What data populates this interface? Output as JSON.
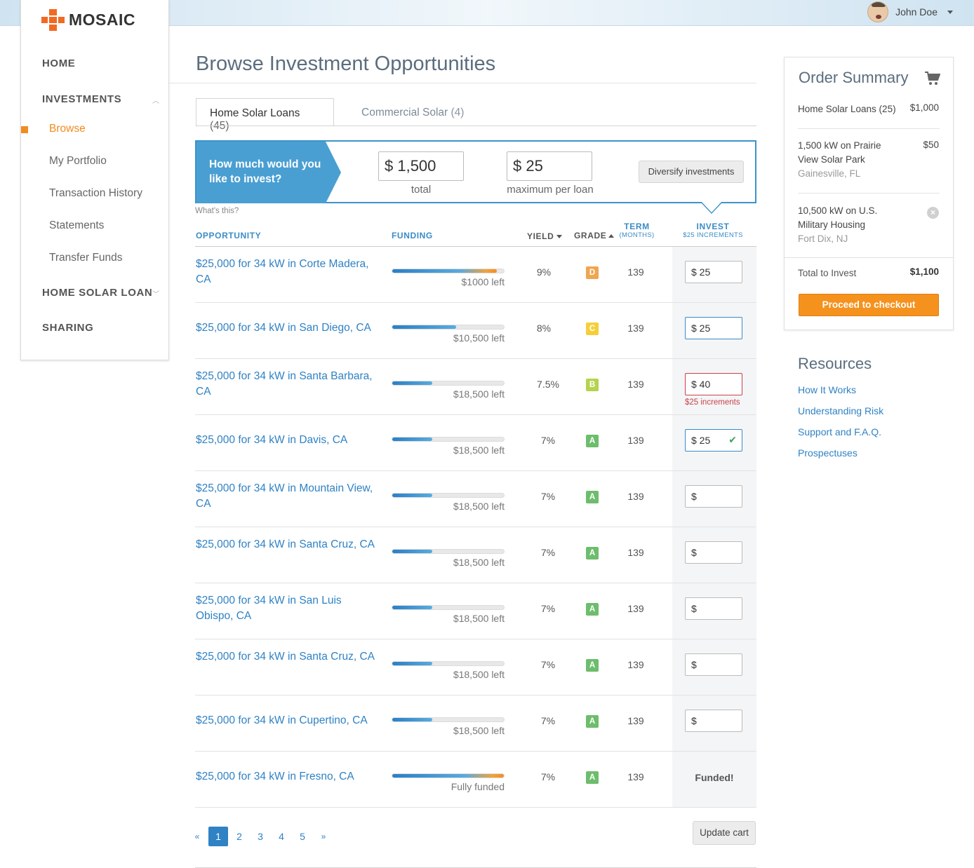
{
  "brand": {
    "name": "MOSAIC",
    "accent": "#f26a21"
  },
  "user": {
    "name": "John Doe"
  },
  "nav": {
    "home": "HOME",
    "investments": "INVESTMENTS",
    "sub": [
      {
        "label": "Browse",
        "active": true
      },
      {
        "label": "My Portfolio"
      },
      {
        "label": "Transaction History"
      },
      {
        "label": "Statements"
      },
      {
        "label": "Transfer Funds"
      }
    ],
    "home_solar_loan": "HOME SOLAR LOAN",
    "sharing": "SHARING"
  },
  "page": {
    "title": "Browse Investment Opportunities"
  },
  "tabs": [
    {
      "label": "Home Solar Loans",
      "count": "(45)",
      "active": true
    },
    {
      "label": "Commercial Solar",
      "count": "(4)",
      "active": false
    }
  ],
  "invest_box": {
    "prompt": "How much would you like to invest?",
    "total_value": "$ 1,500",
    "total_caption": "total",
    "max_value": "$ 25",
    "max_caption": "maximum per loan",
    "diversify_label": "Diversify investments",
    "whats_this": "What's this?"
  },
  "table": {
    "headers": {
      "opportunity": "OPPORTUNITY",
      "funding": "FUNDING",
      "yield": "YIELD",
      "grade": "GRADE",
      "term": "TERM",
      "term_sub": "(MONTHS)",
      "invest": "INVEST",
      "invest_sub": "$25 INCREMENTS"
    },
    "rows": [
      {
        "title": "$25,000 for 34 kW in Corte Madera, CA",
        "funded_fraction": 0.94,
        "left": "$1000 left",
        "yield": "9%",
        "grade": "D",
        "grade_color": "#f0a551",
        "term": "139",
        "invest": "$ 25",
        "state": "normal"
      },
      {
        "title": "$25,000 for 34 kW in San Diego, CA",
        "funded_fraction": 0.57,
        "left": "$10,500 left",
        "yield": "8%",
        "grade": "C",
        "grade_color": "#f5cf3a",
        "term": "139",
        "invest": "$ 25",
        "state": "focus"
      },
      {
        "title": "$25,000 for 34 kW in Santa Barbara, CA",
        "funded_fraction": 0.36,
        "left": "$18,500 left",
        "yield": "7.5%",
        "grade": "B",
        "grade_color": "#b5d34e",
        "term": "139",
        "invest": "$ 40",
        "state": "error",
        "error": "$25 increments"
      },
      {
        "title": "$25,000 for 34 kW in Davis, CA",
        "funded_fraction": 0.36,
        "left": "$18,500 left",
        "yield": "7%",
        "grade": "A",
        "grade_color": "#6dbd6d",
        "term": "139",
        "invest": "$ 25",
        "state": "valid"
      },
      {
        "title": "$25,000 for 34 kW in Mountain View, CA",
        "funded_fraction": 0.36,
        "left": "$18,500 left",
        "yield": "7%",
        "grade": "A",
        "grade_color": "#6dbd6d",
        "term": "139",
        "invest": "$",
        "state": "normal"
      },
      {
        "title": "$25,000 for 34 kW in Santa Cruz, CA",
        "funded_fraction": 0.36,
        "left": "$18,500 left",
        "yield": "7%",
        "grade": "A",
        "grade_color": "#6dbd6d",
        "term": "139",
        "invest": "$",
        "state": "normal"
      },
      {
        "title": "$25,000 for 34 kW in San Luis Obispo, CA",
        "funded_fraction": 0.36,
        "left": "$18,500 left",
        "yield": "7%",
        "grade": "A",
        "grade_color": "#6dbd6d",
        "term": "139",
        "invest": "$",
        "state": "normal"
      },
      {
        "title": "$25,000 for 34 kW in Santa Cruz, CA",
        "funded_fraction": 0.36,
        "left": "$18,500 left",
        "yield": "7%",
        "grade": "A",
        "grade_color": "#6dbd6d",
        "term": "139",
        "invest": "$",
        "state": "normal"
      },
      {
        "title": "$25,000 for 34 kW in Cupertino, CA",
        "funded_fraction": 0.36,
        "left": "$18,500 left",
        "yield": "7%",
        "grade": "A",
        "grade_color": "#6dbd6d",
        "term": "139",
        "invest": "$",
        "state": "normal"
      },
      {
        "title": "$25,000 for 34 kW in Fresno, CA",
        "funded_fraction": 1.0,
        "left": "Fully funded",
        "yield": "7%",
        "grade": "A",
        "grade_color": "#6dbd6d",
        "term": "139",
        "invest": "Funded!",
        "state": "funded"
      }
    ]
  },
  "pagination": {
    "prev": "«",
    "pages": [
      "1",
      "2",
      "3",
      "4",
      "5"
    ],
    "current": "1",
    "next": "»"
  },
  "update_cart_label": "Update cart",
  "summary": {
    "title": "Order Summary",
    "items": [
      {
        "name": "Home Solar Loans (25)",
        "price": "$1,000"
      },
      {
        "name": "1,500 kW on Prairie View Solar Park",
        "location": "Gainesville, FL",
        "price": "$50"
      },
      {
        "name": "10,500 kW on U.S. Military Housing",
        "location": "Fort Dix, NJ",
        "price": ""
      }
    ],
    "total_label": "Total to Invest",
    "total_value": "$1,100",
    "checkout_label": "Proceed to checkout"
  },
  "resources": {
    "title": "Resources",
    "links": [
      "How It Works",
      "Understanding Risk",
      "Support and F.A.Q.",
      "Prospectuses"
    ]
  }
}
